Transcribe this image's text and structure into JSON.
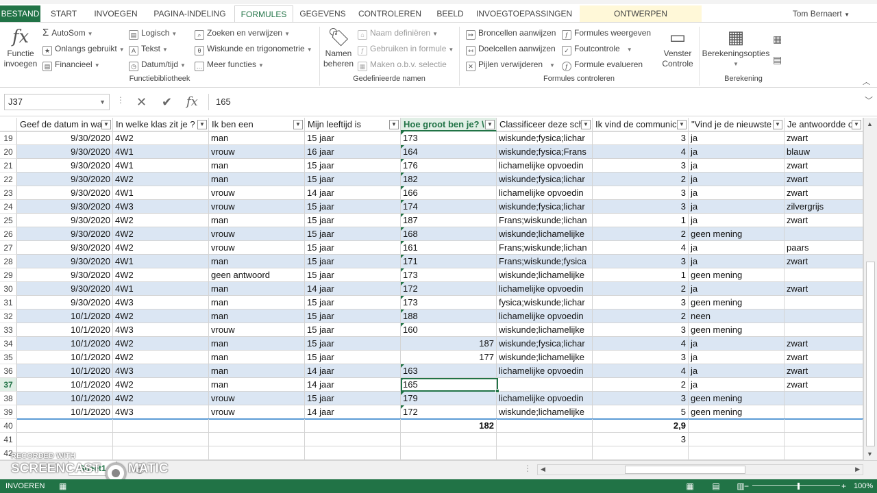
{
  "tabs": {
    "file": "BESTAND",
    "items": [
      "START",
      "INVOEGEN",
      "PAGINA-INDELING",
      "FORMULES",
      "GEGEVENS",
      "CONTROLEREN",
      "BEELD",
      "INVOEGTOEPASSINGEN"
    ],
    "active": "FORMULES",
    "context": "ONTWERPEN",
    "user": "Tom Bernaert"
  },
  "ribbon": {
    "insert_function": "Functie invoegen",
    "autosum": "AutoSom",
    "recent": "Onlangs gebruikt",
    "financial": "Financieel",
    "logical": "Logisch",
    "text": "Tekst",
    "datetime": "Datum/tijd",
    "lookup": "Zoeken en verwijzen",
    "math": "Wiskunde en trigonometrie",
    "more": "Meer functies",
    "group_library": "Functiebibliotheek",
    "name_manager": "Namen beheren",
    "define_name": "Naam definiëren",
    "use_in_formula": "Gebruiken in formule",
    "create_from_selection": "Maken o.b.v. selectie",
    "group_names": "Gedefinieerde namen",
    "trace_precedents": "Broncellen aanwijzen",
    "trace_dependents": "Doelcellen aanwijzen",
    "remove_arrows": "Pijlen verwijderen",
    "show_formulas": "Formules weergeven",
    "error_checking": "Foutcontrole",
    "evaluate_formula": "Formule evalueren",
    "watch_window": "Venster Controle",
    "group_audit": "Formules controleren",
    "calc_options": "Berekeningsopties",
    "group_calc": "Berekening"
  },
  "formula_bar": {
    "name_box": "J37",
    "value": "165"
  },
  "columns": [
    "Geef de datum in wa",
    "In welke klas zit je ?",
    "Ik ben een",
    "Mijn leeftijd is",
    "Hoe groot ben je? \\",
    "Classificeer deze sch",
    "Ik vind de communic",
    "\"Vind je de nieuwste",
    "Je antwoordde op"
  ],
  "rows": [
    {
      "n": "19",
      "c": [
        "9/30/2020",
        "4W2",
        "man",
        "15 jaar",
        "173",
        "wiskunde;fysica;lichar",
        "3",
        "ja",
        "zwart"
      ]
    },
    {
      "n": "20",
      "c": [
        "9/30/2020",
        "4W1",
        "vrouw",
        "16 jaar",
        "164",
        "wiskunde;fysica;Frans",
        "4",
        "ja",
        "blauw"
      ]
    },
    {
      "n": "21",
      "c": [
        "9/30/2020",
        "4W1",
        "man",
        "15 jaar",
        "176",
        "lichamelijke opvoedin",
        "3",
        "ja",
        "zwart"
      ]
    },
    {
      "n": "22",
      "c": [
        "9/30/2020",
        "4W2",
        "man",
        "15 jaar",
        "182",
        "wiskunde;fysica;lichar",
        "2",
        "ja",
        "zwart"
      ]
    },
    {
      "n": "23",
      "c": [
        "9/30/2020",
        "4W1",
        "vrouw",
        "14 jaar",
        "166",
        "lichamelijke opvoedin",
        "3",
        "ja",
        "zwart"
      ]
    },
    {
      "n": "24",
      "c": [
        "9/30/2020",
        "4W3",
        "vrouw",
        "15 jaar",
        "174",
        "wiskunde;fysica;lichar",
        "3",
        "ja",
        "zilvergrijs"
      ]
    },
    {
      "n": "25",
      "c": [
        "9/30/2020",
        "4W2",
        "man",
        "15 jaar",
        "187",
        "Frans;wiskunde;lichan",
        "1",
        "ja",
        "zwart"
      ]
    },
    {
      "n": "26",
      "c": [
        "9/30/2020",
        "4W2",
        "vrouw",
        "15 jaar",
        "168",
        "wiskunde;lichamelijke",
        "2",
        "geen mening",
        ""
      ]
    },
    {
      "n": "27",
      "c": [
        "9/30/2020",
        "4W2",
        "vrouw",
        "15 jaar",
        "161",
        "Frans;wiskunde;lichan",
        "4",
        "ja",
        "paars"
      ]
    },
    {
      "n": "28",
      "c": [
        "9/30/2020",
        "4W1",
        "man",
        "15 jaar",
        "171",
        "Frans;wiskunde;fysica",
        "3",
        "ja",
        "zwart"
      ]
    },
    {
      "n": "29",
      "c": [
        "9/30/2020",
        "4W2",
        "geen antwoord",
        "15 jaar",
        "173",
        "wiskunde;lichamelijke",
        "1",
        "geen mening",
        ""
      ]
    },
    {
      "n": "30",
      "c": [
        "9/30/2020",
        "4W1",
        "man",
        "14 jaar",
        "172",
        "lichamelijke opvoedin",
        "2",
        "ja",
        "zwart"
      ]
    },
    {
      "n": "31",
      "c": [
        "9/30/2020",
        "4W3",
        "man",
        "15 jaar",
        "173",
        "fysica;wiskunde;lichar",
        "3",
        "geen mening",
        ""
      ]
    },
    {
      "n": "32",
      "c": [
        "10/1/2020",
        "4W2",
        "man",
        "15 jaar",
        "188",
        "lichamelijke opvoedin",
        "2",
        "neen",
        ""
      ]
    },
    {
      "n": "33",
      "c": [
        "10/1/2020",
        "4W3",
        "vrouw",
        "15 jaar",
        "160",
        "wiskunde;lichamelijke",
        "3",
        "geen mening",
        ""
      ]
    },
    {
      "n": "34",
      "c": [
        "10/1/2020",
        "4W2",
        "man",
        "15 jaar",
        "187",
        "wiskunde;fysica;lichar",
        "4",
        "ja",
        "zwart"
      ]
    },
    {
      "n": "35",
      "c": [
        "10/1/2020",
        "4W2",
        "man",
        "15 jaar",
        "177",
        "wiskunde;lichamelijke",
        "3",
        "ja",
        "zwart"
      ]
    },
    {
      "n": "36",
      "c": [
        "10/1/2020",
        "4W3",
        "man",
        "14 jaar",
        "163",
        "lichamelijke opvoedin",
        "4",
        "ja",
        "zwart"
      ]
    },
    {
      "n": "37",
      "c": [
        "10/1/2020",
        "4W2",
        "man",
        "14 jaar",
        "165",
        "",
        "2",
        "ja",
        "zwart"
      ]
    },
    {
      "n": "38",
      "c": [
        "10/1/2020",
        "4W2",
        "vrouw",
        "15 jaar",
        "179",
        "lichamelijke opvoedin",
        "3",
        "geen mening",
        ""
      ]
    },
    {
      "n": "39",
      "c": [
        "10/1/2020",
        "4W3",
        "vrouw",
        "14 jaar",
        "172",
        "wiskunde;lichamelijke",
        "5",
        "geen mening",
        ""
      ]
    },
    {
      "n": "40",
      "c": [
        "",
        "",
        "",
        "",
        "182",
        "",
        "2,9",
        "",
        ""
      ]
    },
    {
      "n": "41",
      "c": [
        "",
        "",
        "",
        "",
        "",
        "",
        "3",
        "",
        ""
      ]
    },
    {
      "n": "42",
      "c": [
        "",
        "",
        "",
        "",
        "",
        "",
        "",
        "",
        ""
      ]
    }
  ],
  "sheet_tab": "Sheet1",
  "watermark": {
    "top": "RECORDED WITH",
    "brand": "SCREENCAST",
    "brand2": "MATIC"
  },
  "status": {
    "mode": "INVOEREN",
    "zoom": "100%"
  }
}
